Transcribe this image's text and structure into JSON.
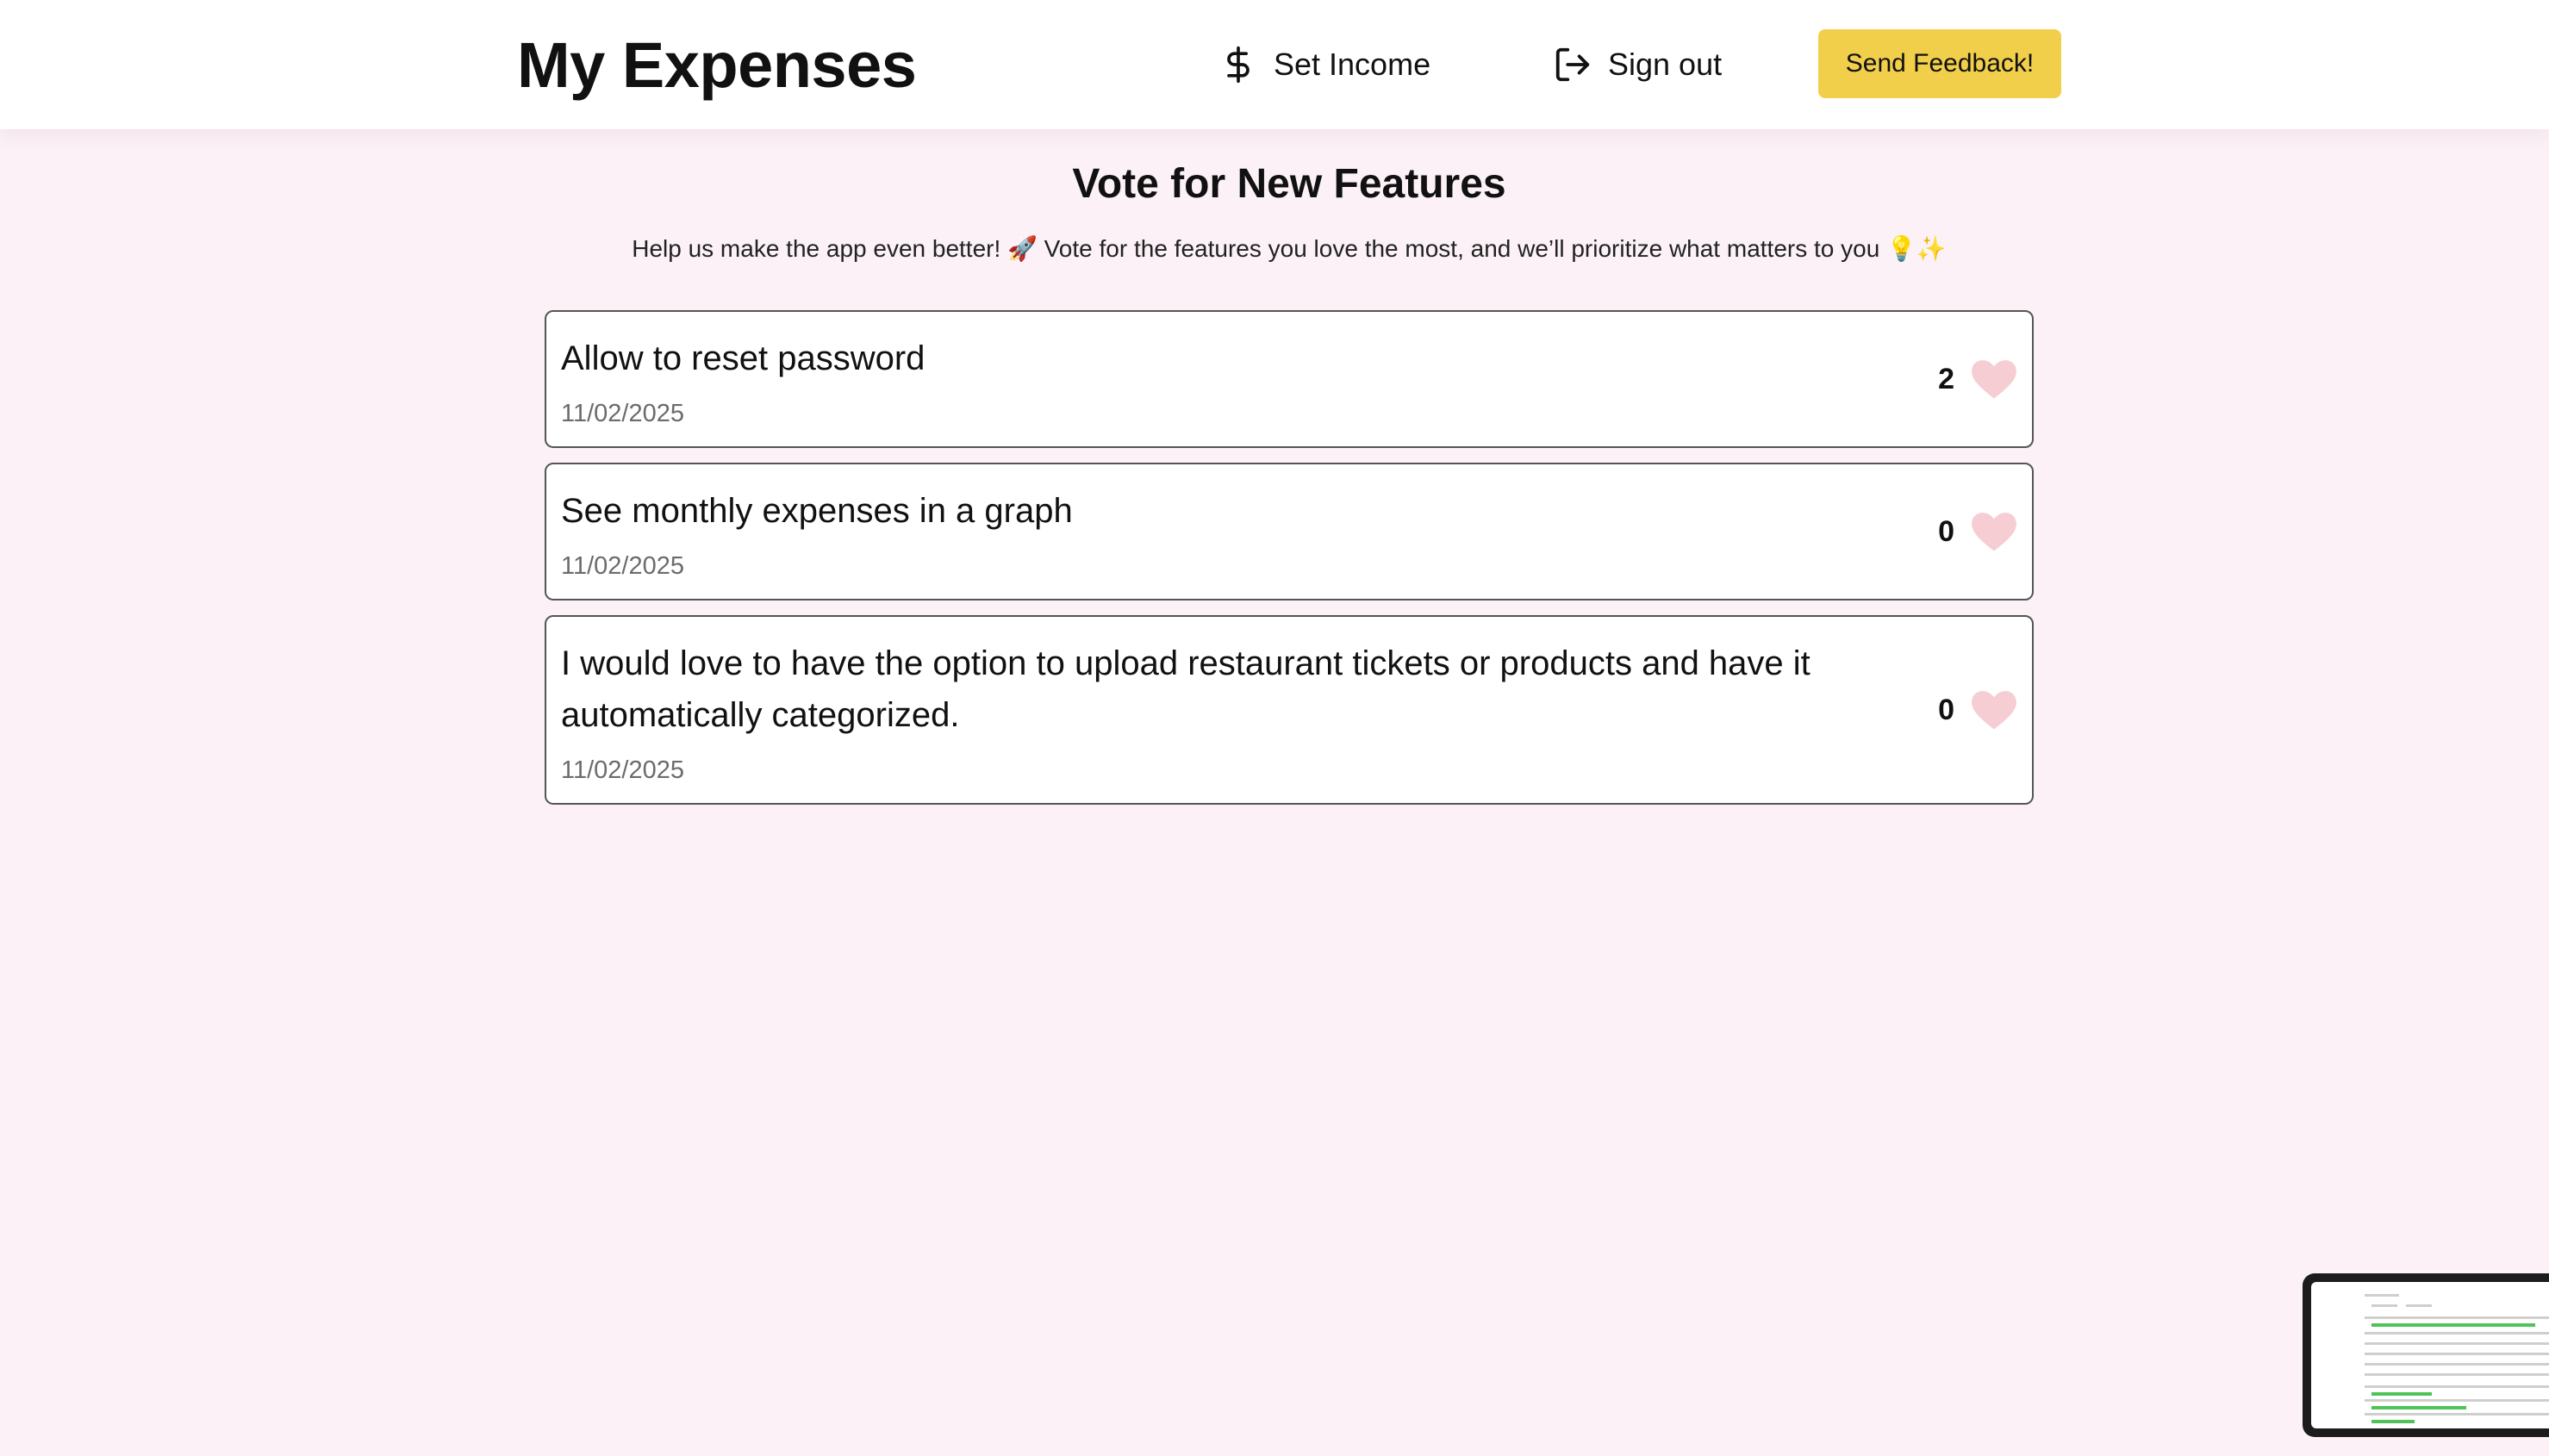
{
  "header": {
    "brand": "My Expenses",
    "set_income_label": "Set Income",
    "sign_out_label": "Sign out",
    "feedback_label": "Send Feedback!"
  },
  "main": {
    "title": "Vote for New Features",
    "subtitle": "Help us make the app even better! 🚀 Vote for the features you love the most, and we’ll prioritize what matters to you 💡✨",
    "features": [
      {
        "title": "Allow to reset password",
        "date": "11/02/2025",
        "votes": "2"
      },
      {
        "title": "See monthly expenses in a graph",
        "date": "11/02/2025",
        "votes": "0"
      },
      {
        "title": "I would love to have the option to upload restaurant tickets or products and have it automatically categorized.",
        "date": "11/02/2025",
        "votes": "0"
      }
    ]
  },
  "colors": {
    "background": "#fbf1f6",
    "accent_button": "#f2cf4a",
    "heart": "#f5cdd3"
  },
  "icons": [
    "dollar-icon",
    "sign-out-icon",
    "heart-icon"
  ]
}
